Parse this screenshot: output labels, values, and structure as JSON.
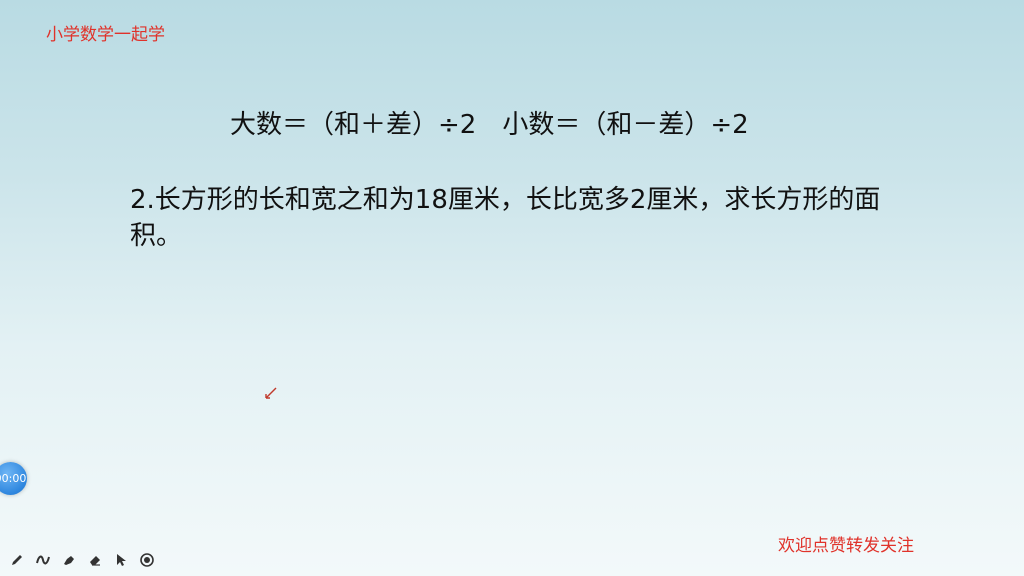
{
  "brand": {
    "text": "小学数学一起学"
  },
  "formula": {
    "big": "大数＝（和＋差）÷2",
    "small": "小数＝（和－差）÷2"
  },
  "problem": {
    "text": "2.长方形的长和宽之和为18厘米，长比宽多2厘米，求长方形的面积。"
  },
  "timer": {
    "text": "00:00"
  },
  "toolbar": {
    "icons": [
      "pen-icon",
      "curve-icon",
      "highlighter-icon",
      "eraser-icon",
      "pointer-icon",
      "record-icon"
    ]
  },
  "footer": {
    "text": "欢迎点赞转发关注"
  },
  "colors": {
    "accent": "#e0322a",
    "timer": "#2e86de"
  }
}
